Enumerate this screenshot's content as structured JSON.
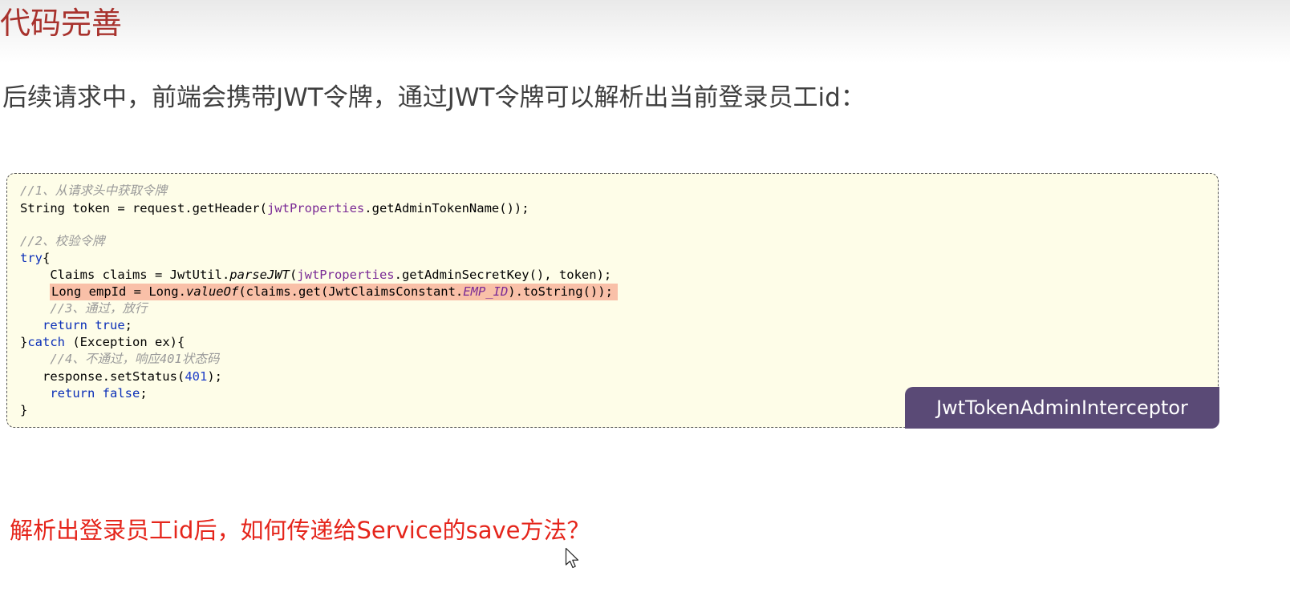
{
  "slide": {
    "title": "代码完善",
    "subtitle": "后续请求中，前端会携带JWT令牌，通过JWT令牌可以解析出当前登录员工id：",
    "question": "解析出登录员工id后，如何传递给Service的save方法？"
  },
  "code": {
    "class_label": "JwtTokenAdminInterceptor",
    "lines": {
      "l1": "//1、从请求头中获取令牌",
      "l2_a": "String token = request.getHeader(",
      "l2_b": "jwtProperties",
      "l2_c": ".getAdminTokenName());",
      "l4": "//2、校验令牌",
      "l5_a": "try",
      "l5_b": "{",
      "l6_a": "    Claims claims = JwtUtil.",
      "l6_b": "parseJWT",
      "l6_c": "(",
      "l6_d": "jwtProperties",
      "l6_e": ".getAdminSecretKey(), token);",
      "l7_a": "Long empId = Long.",
      "l7_b": "valueOf",
      "l7_c": "(claims.get(JwtClaimsConstant.",
      "l7_d": "EMP_ID",
      "l7_e": ").toString());",
      "l8": "    //3、通过，放行",
      "l9_a": "   ",
      "l9_b": "return true",
      "l9_c": ";",
      "l10_a": "}",
      "l10_b": "catch",
      "l10_c": " (Exception ex){",
      "l11": "    //4、不通过，响应401状态码",
      "l12_a": "   response.setStatus(",
      "l12_b": "401",
      "l12_c": ");",
      "l13_a": "    ",
      "l13_b": "return false",
      "l13_c": ";",
      "l14": "}"
    }
  },
  "colors": {
    "title": "#a8322d",
    "question": "#e5251b",
    "code_background": "#fefde8",
    "highlight": "#f9c0a8",
    "class_label_background": "#5a4a76"
  },
  "icons": {
    "cursor": "mouse-pointer-icon"
  }
}
